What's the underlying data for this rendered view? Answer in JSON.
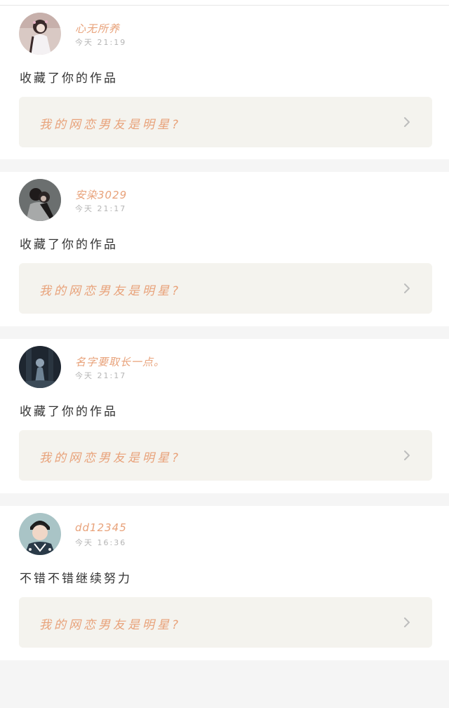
{
  "colors": {
    "username": "#e8a27a",
    "time": "#b5b5b5",
    "link_bg": "#f4f3ee",
    "separator": "#f5f5f5"
  },
  "notifications": [
    {
      "username": "心无所养",
      "time": "今天 21:19",
      "action": "收藏了你的作品",
      "work_title": "我的网恋男友是明星?",
      "avatar_icon": "avatar-girl-white-dress-icon"
    },
    {
      "username": "安染3029",
      "time": "今天 21:17",
      "action": "收藏了你的作品",
      "work_title": "我的网恋男友是明星?",
      "avatar_icon": "avatar-couple-icon"
    },
    {
      "username": "名字要取长一点。",
      "time": "今天 21:17",
      "action": "收藏了你的作品",
      "work_title": "我的网恋男友是明星?",
      "avatar_icon": "avatar-dark-scene-icon"
    },
    {
      "username": "dd12345",
      "time": "今天 16:36",
      "action": "不错不错继续努力",
      "work_title": "我的网恋男友是明星?",
      "avatar_icon": "avatar-boy-icon"
    }
  ]
}
